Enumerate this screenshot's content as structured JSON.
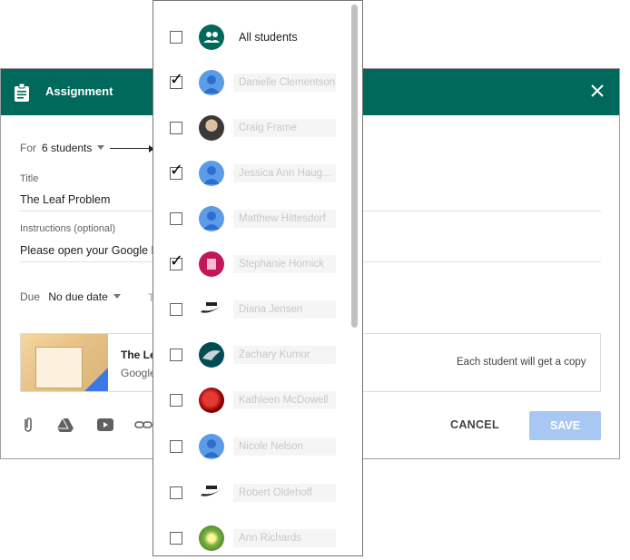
{
  "header": {
    "title": "Assignment"
  },
  "form": {
    "for_label": "For",
    "for_value": "6 students",
    "title_label": "Title",
    "title_value": "The Leaf Problem",
    "instructions_label": "Instructions (optional)",
    "instructions_value": "Please open your Google Doc",
    "due_label": "Due",
    "due_value": "No due date",
    "topic_partial": "T"
  },
  "attachment": {
    "title": "The Le",
    "subtitle": "Google",
    "copy_note": "Each student will get a copy"
  },
  "actions": {
    "cancel": "CANCEL",
    "save": "SAVE"
  },
  "students": [
    {
      "name": "All students",
      "checked": false,
      "icon": "group-icon"
    },
    {
      "name": "Danielle Clementson",
      "checked": true,
      "icon": "default-avatar"
    },
    {
      "name": "Craig Frame",
      "checked": false,
      "icon": "photo-avatar"
    },
    {
      "name": "Jessica Ann Haug...",
      "checked": true,
      "icon": "default-avatar"
    },
    {
      "name": "Matthew Hittesdorf",
      "checked": false,
      "icon": "default-avatar"
    },
    {
      "name": "Stephanie Hornick",
      "checked": true,
      "icon": "photo-avatar"
    },
    {
      "name": "Diana Jensen",
      "checked": false,
      "icon": "math-logo-avatar"
    },
    {
      "name": "Zachary Kumor",
      "checked": false,
      "icon": "eagle-logo-avatar"
    },
    {
      "name": "Kathleen McDowell",
      "checked": false,
      "icon": "photo-avatar"
    },
    {
      "name": "Nicole Nelson",
      "checked": false,
      "icon": "default-avatar"
    },
    {
      "name": "Robert Oldehoff",
      "checked": false,
      "icon": "math-logo-avatar"
    },
    {
      "name": "Ann Richards",
      "checked": false,
      "icon": "photo-avatar"
    }
  ],
  "colors": {
    "header": "#00695c",
    "save": "#a9c7f3",
    "avatar_default": "#5c9ce6"
  }
}
